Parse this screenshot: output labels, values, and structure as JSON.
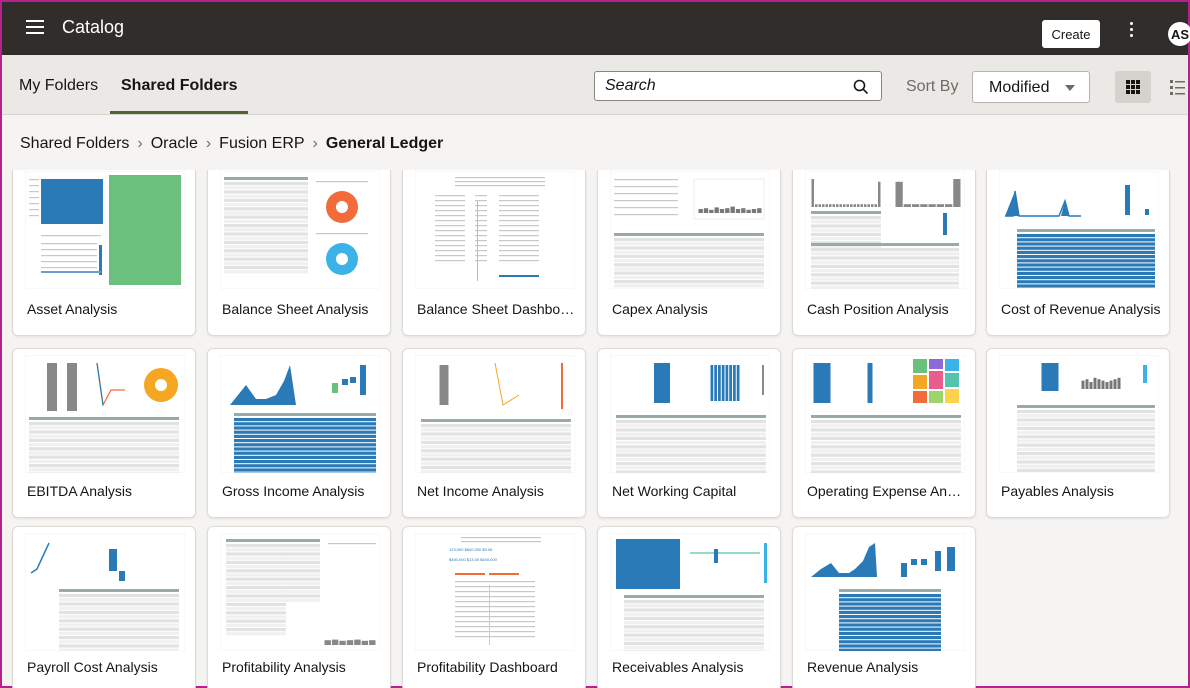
{
  "header": {
    "title": "Catalog",
    "create_label": "Create",
    "avatar_initials": "AS"
  },
  "tabs": {
    "my_folders": "My Folders",
    "shared_folders": "Shared Folders",
    "active": "shared_folders"
  },
  "search": {
    "placeholder": "Search",
    "value": ""
  },
  "sort": {
    "label": "Sort By",
    "value": "Modified"
  },
  "view": {
    "mode": "grid"
  },
  "breadcrumb": {
    "items": [
      "Shared Folders",
      "Oracle",
      "Fusion ERP"
    ],
    "current": "General Ledger"
  },
  "cards": [
    {
      "label": "Asset Analysis",
      "thumb": "asset"
    },
    {
      "label": "Balance Sheet Analysis",
      "thumb": "balance"
    },
    {
      "label": "Balance Sheet Dashboard",
      "thumb": "bsdash"
    },
    {
      "label": "Capex Analysis",
      "thumb": "capex"
    },
    {
      "label": "Cash Position Analysis",
      "thumb": "cash"
    },
    {
      "label": "Cost of Revenue Analysis",
      "thumb": "costrev"
    },
    {
      "label": "EBITDA Analysis",
      "thumb": "ebitda"
    },
    {
      "label": "Gross Income Analysis",
      "thumb": "gross"
    },
    {
      "label": "Net Income Analysis",
      "thumb": "netinc"
    },
    {
      "label": "Net Working Capital",
      "thumb": "nwc"
    },
    {
      "label": "Operating Expense Anal...",
      "thumb": "opex"
    },
    {
      "label": "Payables Analysis",
      "thumb": "payables"
    },
    {
      "label": "Payroll Cost Analysis",
      "thumb": "payroll"
    },
    {
      "label": "Profitability Analysis",
      "thumb": "profit"
    },
    {
      "label": "Profitability Dashboard",
      "thumb": "profdash"
    },
    {
      "label": "Receivables Analysis",
      "thumb": "receiv"
    },
    {
      "label": "Revenue Analysis",
      "thumb": "revenue"
    }
  ],
  "colors": {
    "topbar": "#312d2a",
    "accent_underline": "#4c6336",
    "chart_blue": "#2a7ab8",
    "chart_green": "#6cc07d",
    "chart_orange": "#f26b3a",
    "chart_cyan": "#3bb3e8",
    "frame_border": "#b5218e"
  }
}
